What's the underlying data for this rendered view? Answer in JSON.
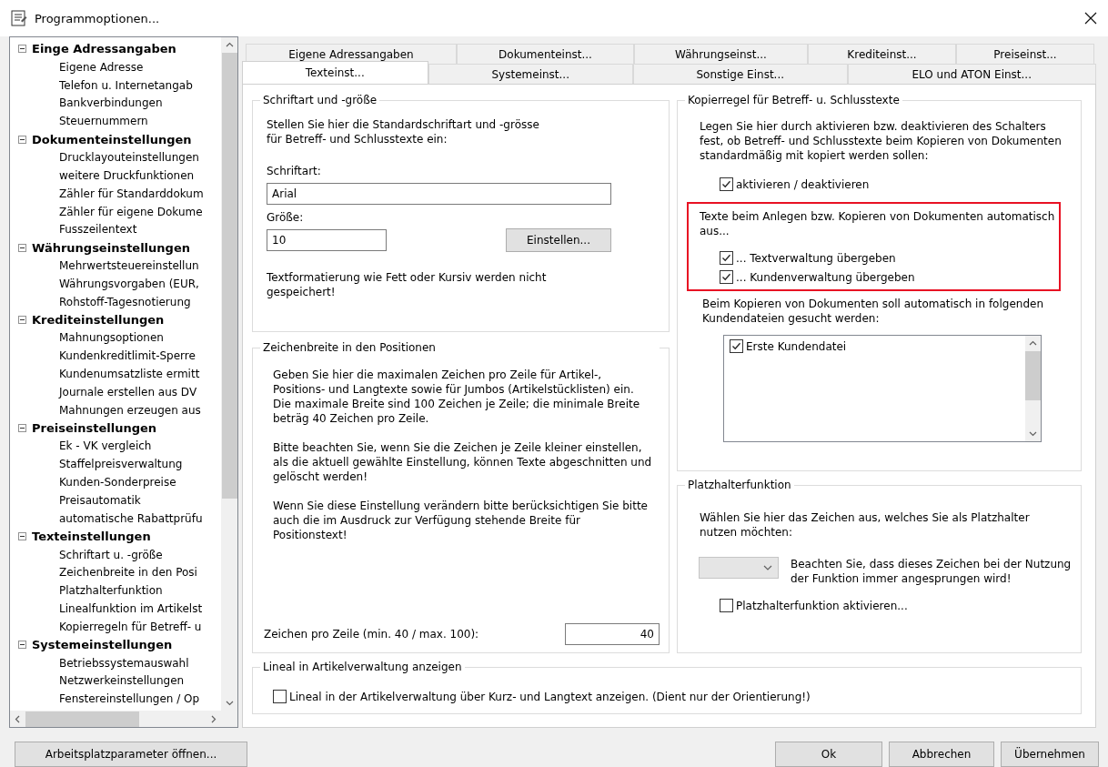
{
  "window": {
    "title": "Programmoptionen..."
  },
  "tree": {
    "items": [
      {
        "label": "Einge Adressangaben",
        "expanded": true,
        "children": [
          {
            "label": "Eigene Adresse"
          },
          {
            "label": "Telefon u. Internetangab"
          },
          {
            "label": "Bankverbindungen"
          },
          {
            "label": "Steuernummern"
          }
        ]
      },
      {
        "label": "Dokumenteinstellungen",
        "expanded": true,
        "children": [
          {
            "label": "Drucklayouteinstellungen"
          },
          {
            "label": "weitere Druckfunktionen"
          },
          {
            "label": "Zähler für Standarddokum"
          },
          {
            "label": "Zähler für eigene Dokume"
          },
          {
            "label": "Fusszeilentext"
          }
        ]
      },
      {
        "label": "Währungseinstellungen",
        "expanded": true,
        "children": [
          {
            "label": "Mehrwertsteuereinstellun"
          },
          {
            "label": "Währungsvorgaben (EUR,"
          },
          {
            "label": "Rohstoff-Tagesnotierung"
          }
        ]
      },
      {
        "label": "Krediteinstellungen",
        "expanded": true,
        "children": [
          {
            "label": "Mahnungsoptionen"
          },
          {
            "label": "Kundenkreditlimit-Sperre"
          },
          {
            "label": "Kundenumsatzliste ermitt"
          },
          {
            "label": "Journale erstellen aus DV"
          },
          {
            "label": "Mahnungen erzeugen aus"
          }
        ]
      },
      {
        "label": "Preiseinstellungen",
        "expanded": true,
        "children": [
          {
            "label": "Ek - VK vergleich"
          },
          {
            "label": "Staffelpreisverwaltung"
          },
          {
            "label": "Kunden-Sonderpreise"
          },
          {
            "label": "Preisautomatik"
          },
          {
            "label": "automatische Rabattprüfu"
          }
        ]
      },
      {
        "label": "Texteinstellungen",
        "expanded": true,
        "children": [
          {
            "label": "Schriftart u. -größe"
          },
          {
            "label": "Zeichenbreite in den Posi"
          },
          {
            "label": "Platzhalterfunktion"
          },
          {
            "label": "Linealfunktion im Artikelst"
          },
          {
            "label": "Kopierregeln für Betreff- u"
          }
        ]
      },
      {
        "label": "Systemeinstellungen",
        "expanded": true,
        "children": [
          {
            "label": "Betriebssystemauswahl"
          },
          {
            "label": "Netzwerkeinstellungen"
          },
          {
            "label": "Fenstereinstellungen / Op"
          }
        ]
      }
    ]
  },
  "tab_rows": [
    {
      "tabs": [
        {
          "label": "Eigene Adressangaben",
          "selected": false
        },
        {
          "label": "Dokumenteinst...",
          "selected": false
        },
        {
          "label": "Währungseinst...",
          "selected": false
        },
        {
          "label": "Krediteinst...",
          "selected": false
        },
        {
          "label": "Preiseinst...",
          "selected": false
        }
      ]
    },
    {
      "tabs": [
        {
          "label": "Texteinst...",
          "selected": true
        },
        {
          "label": "Systemeinst...",
          "selected": false
        },
        {
          "label": "Sonstige Einst...",
          "selected": false
        },
        {
          "label": "ELO und ATON Einst...",
          "selected": false
        }
      ]
    }
  ],
  "font_group": {
    "title": "Schriftart und -größe",
    "intro": "Stellen Sie hier die Standardschriftart und -grösse für Betreff- und Schlusstexte ein:",
    "font_label": "Schriftart:",
    "font_value": "Arial",
    "size_label": "Größe:",
    "size_value": "10",
    "settings_button": "Einstellen...",
    "note": "Textformatierung wie Fett oder Kursiv werden nicht gespeichert!"
  },
  "width_group": {
    "title": "Zeichenbreite in den Positionen",
    "paragraphs": [
      "Geben Sie hier die maximalen Zeichen pro Zeile für Artikel-, Positions- und Langtexte sowie für Jumbos (Artikelstücklisten) ein. Die maximale Breite sind 100 Zeichen je Zeile; die minimale Breite beträg 40 Zeichen pro Zeile.",
      "Bitte beachten Sie, wenn Sie die Zeichen je Zeile kleiner einstellen, als die aktuell gewählte Einstellung, können Texte abgeschnitten und gelöscht werden!",
      "Wenn Sie diese Einstellung verändern bitte berücksichtigen Sie bitte auch die im Ausdruck zur Verfügung stehende Breite für Positionstext!"
    ],
    "chars_label": "Zeichen pro Zeile (min. 40 / max. 100):",
    "chars_value": "40"
  },
  "copy_group": {
    "title": "Kopierregel für Betreff- u. Schlusstexte",
    "intro": "Legen Sie hier durch aktivieren bzw. deaktivieren des Schalters fest, ob Betreff- und Schlusstexte beim Kopieren von Dokumenten standardmäßig mit kopiert werden sollen:",
    "toggle": {
      "label": "aktivieren / deaktivieren",
      "checked": true
    },
    "highlight": {
      "text": "Texte beim Anlegen bzw. Kopieren von Dokumenten automatisch aus...",
      "options": [
        {
          "label": "... Textverwaltung übergeben",
          "checked": true
        },
        {
          "label": "... Kundenverwaltung übergeben",
          "checked": true
        }
      ]
    },
    "search_text": "Beim Kopieren von Dokumenten soll automatisch in folgenden Kundendateien gesucht werden:",
    "customer_files": [
      {
        "label": "Erste Kundendatei",
        "checked": true
      }
    ]
  },
  "placeholder_group": {
    "title": "Platzhalterfunktion",
    "intro": "Wählen Sie hier das Zeichen aus, welches Sie als Platzhalter nutzen möchten:",
    "note": "Beachten Sie, dass dieses Zeichen bei der Nutzung der Funktion immer angesprungen wird!",
    "enable": {
      "label": "Platzhalterfunktion aktivieren...",
      "checked": false
    }
  },
  "ruler_group": {
    "title": "Lineal in Artikelverwaltung anzeigen",
    "option": {
      "label": "Lineal in der Artikelverwaltung über Kurz- und Langtext anzeigen. (Dient nur der Orientierung!)",
      "checked": false
    }
  },
  "buttons": {
    "workstation": "Arbeitsplatzparameter öffnen...",
    "actions": [
      "Ok",
      "Abbrechen",
      "Übernehmen"
    ]
  }
}
